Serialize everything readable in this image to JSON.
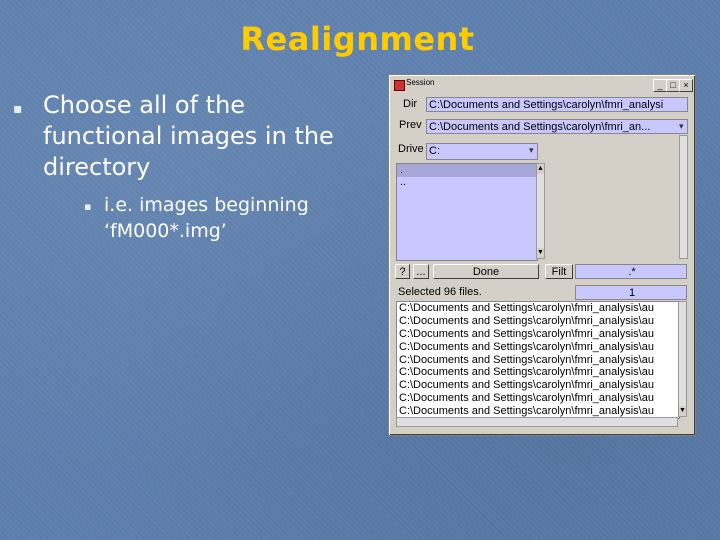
{
  "slide": {
    "title": "Realignment",
    "bullet_main": "Choose all of the functional images in the directory",
    "bullet_sub": "i.e. images beginning ‘fM000*.img’"
  },
  "window": {
    "title": "Session",
    "dir_label": "Dir",
    "dir_value": "C:\\Documents and Settings\\carolyn\\fmri_analysi",
    "prev_label": "Prev",
    "prev_value": "C:\\Documents and Settings\\carolyn\\fmri_an...",
    "drive_label": "Drive",
    "drive_value": "C:",
    "dir_list": [
      ".",
      ".."
    ],
    "help_label": "?",
    "ellipsis_label": "...",
    "done_label": "Done",
    "filt_label": "Filt",
    "filt_value": ".*",
    "status": "Selected 96 files.",
    "count_value": "1",
    "file_rows": [
      "C:\\Documents and Settings\\carolyn\\fmri_analysis\\au",
      "C:\\Documents and Settings\\carolyn\\fmri_analysis\\au",
      "C:\\Documents and Settings\\carolyn\\fmri_analysis\\au",
      "C:\\Documents and Settings\\carolyn\\fmri_analysis\\au",
      "C:\\Documents and Settings\\carolyn\\fmri_analysis\\au",
      "C:\\Documents and Settings\\carolyn\\fmri_analysis\\au",
      "C:\\Documents and Settings\\carolyn\\fmri_analysis\\au",
      "C:\\Documents and Settings\\carolyn\\fmri_analysis\\au",
      "C:\\Documents and Settings\\carolyn\\fmri_analysis\\au"
    ]
  },
  "colors": {
    "title": "#ffcc00",
    "background": "#5d7fae",
    "field": "#c8c8ff"
  }
}
